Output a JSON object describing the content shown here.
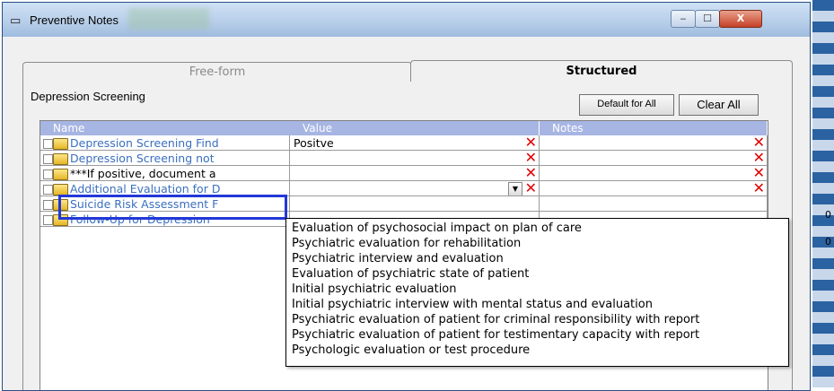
{
  "window": {
    "title": "Preventive Notes",
    "minimize": "‒",
    "maximize": "☐",
    "close": "X"
  },
  "tabs": [
    {
      "label": "Free-form",
      "active": false
    },
    {
      "label": "Structured",
      "active": true
    }
  ],
  "section": {
    "title": "Depression Screening",
    "buttons": {
      "default_all": "Default for All",
      "clear_all": "Clear All"
    }
  },
  "grid": {
    "columns": [
      "Name",
      "Value",
      "Notes"
    ],
    "rows": [
      {
        "name": "Depression Screening Find",
        "value": "Positve",
        "notes": "",
        "delete": "✕"
      },
      {
        "name": "Depression Screening not",
        "value": "",
        "notes": "",
        "delete": "✕"
      },
      {
        "name": "***If positive, document a",
        "value": "",
        "notes": "",
        "delete": "✕"
      },
      {
        "name": "Additional Evaluation for D",
        "value": "",
        "notes": "",
        "delete": "✕"
      },
      {
        "name": "Suicide Risk Assessment F",
        "value": "",
        "notes": "",
        "delete": "✕"
      },
      {
        "name": "Follow-Up for Depression",
        "value": "",
        "notes": "",
        "delete": "✕"
      }
    ]
  },
  "dropdown": {
    "arrow": "▼",
    "options": [
      "Evaluation of psychosocial impact on plan of care",
      "Psychiatric evaluation for rehabilitation",
      "Psychiatric interview and evaluation",
      "Evaluation of psychiatric state of patient",
      "Initial psychiatric evaluation",
      "Initial psychiatric interview with mental status and evaluation",
      "Psychiatric evaluation of patient for criminal responsibility with report",
      "Psychiatric evaluation of patient for testimentary capacity with report",
      "Psychologic evaluation or test procedure"
    ]
  },
  "background": {
    "right_text": [
      "0",
      "0"
    ]
  },
  "colors": {
    "header": "#a7b5e3",
    "link": "#3a6fbf",
    "delete": "#e00000",
    "highlight": "#2238d8"
  }
}
